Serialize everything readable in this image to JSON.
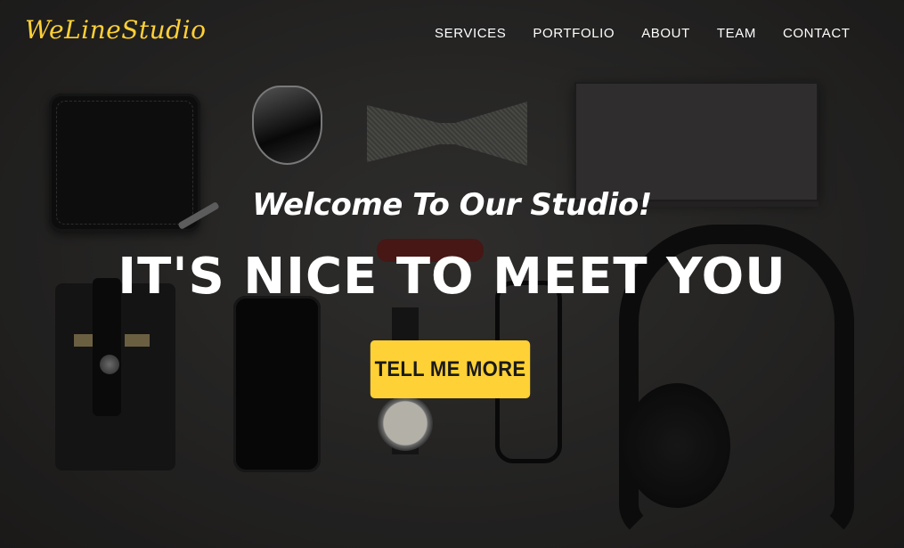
{
  "brand": {
    "logo_text": "WeLineStudio",
    "accent_color": "#fed136"
  },
  "nav": {
    "items": [
      {
        "label": "SERVICES"
      },
      {
        "label": "PORTFOLIO"
      },
      {
        "label": "ABOUT"
      },
      {
        "label": "TEAM"
      },
      {
        "label": "CONTACT"
      }
    ]
  },
  "hero": {
    "subheading": "Welcome To Our Studio!",
    "heading": "IT'S NICE TO MEET YOU",
    "cta_label": "TELL ME MORE",
    "background": "flat-lay-accessories-photo"
  }
}
